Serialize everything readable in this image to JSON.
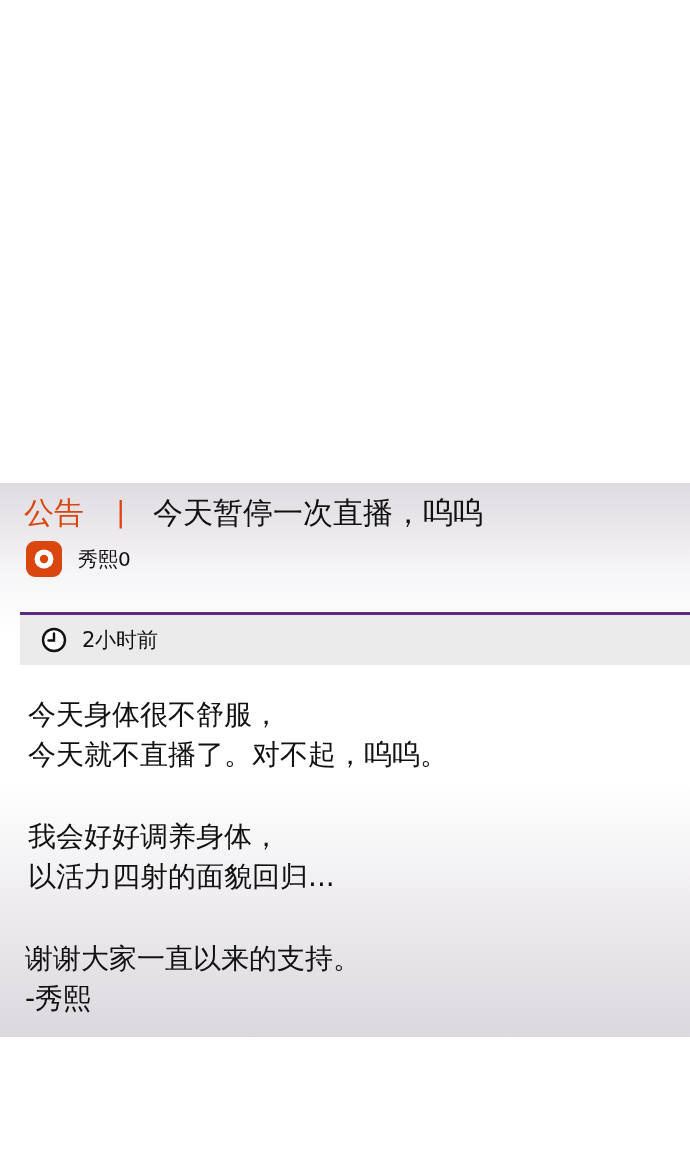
{
  "notice": {
    "tag": "公告",
    "separator": "|",
    "title": "今天暂停一次直播，呜呜"
  },
  "author": {
    "name": "秀熙0"
  },
  "time": {
    "label": "2小时前"
  },
  "body": {
    "paragraphs": [
      [
        "今天身体很不舒服，",
        "今天就不直播了。对不起，呜呜。"
      ],
      [
        "我会好好调养身体，",
        "以活力四射的面貌回归..."
      ],
      [
        "谢谢大家一直以来的支持。",
        "-秀熙"
      ]
    ]
  }
}
